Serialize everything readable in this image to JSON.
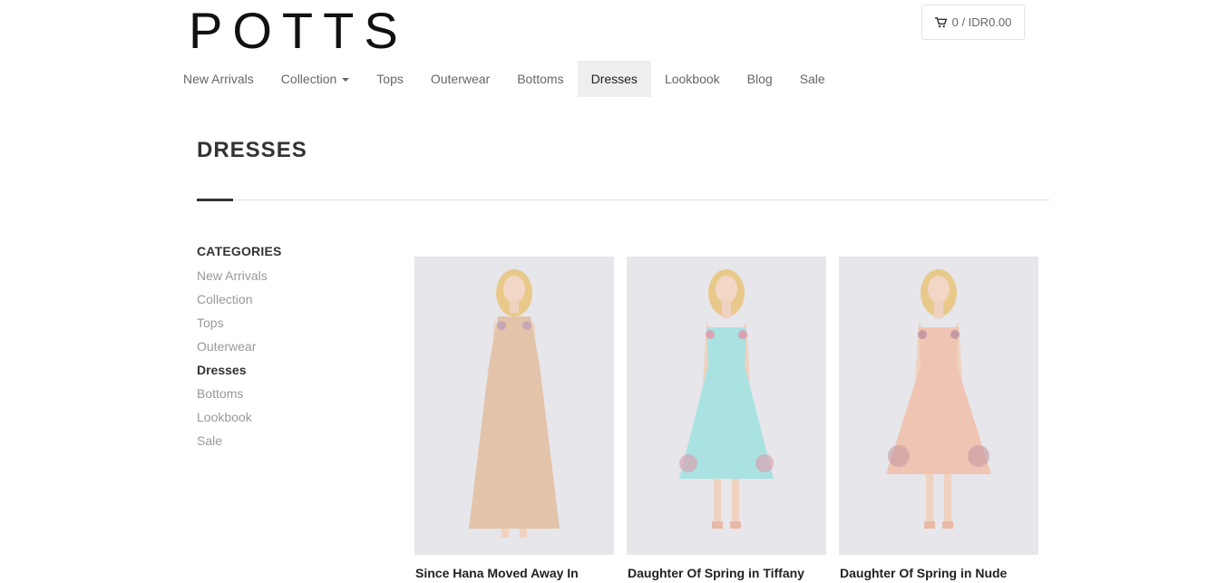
{
  "brand": {
    "logo_text": "POTTS"
  },
  "cart": {
    "label": "0 / IDR0.00"
  },
  "nav": {
    "items": [
      {
        "label": "New Arrivals"
      },
      {
        "label": "Collection"
      },
      {
        "label": "Tops"
      },
      {
        "label": "Outerwear"
      },
      {
        "label": "Bottoms"
      },
      {
        "label": "Dresses"
      },
      {
        "label": "Lookbook"
      },
      {
        "label": "Blog"
      },
      {
        "label": "Sale"
      }
    ],
    "active": "Dresses"
  },
  "page": {
    "title": "DRESSES"
  },
  "sidebar": {
    "heading": "CATEGORIES",
    "items": [
      {
        "label": "New Arrivals"
      },
      {
        "label": "Collection"
      },
      {
        "label": "Tops"
      },
      {
        "label": "Outerwear"
      },
      {
        "label": "Dresses"
      },
      {
        "label": "Bottoms"
      },
      {
        "label": "Lookbook"
      },
      {
        "label": "Sale"
      }
    ],
    "active": "Dresses"
  },
  "products": [
    {
      "name": "Since Hana Moved Away In",
      "dress_color": "#e3c3aa"
    },
    {
      "name": "Daughter Of Spring in Tiffany",
      "dress_color": "#a9e2e1"
    },
    {
      "name": "Daughter Of Spring in Nude",
      "dress_color": "#f0c4b3"
    }
  ],
  "colors": {
    "nav_active_bg": "#eeeeee",
    "text_dark": "#333333",
    "text_muted": "#999999"
  }
}
